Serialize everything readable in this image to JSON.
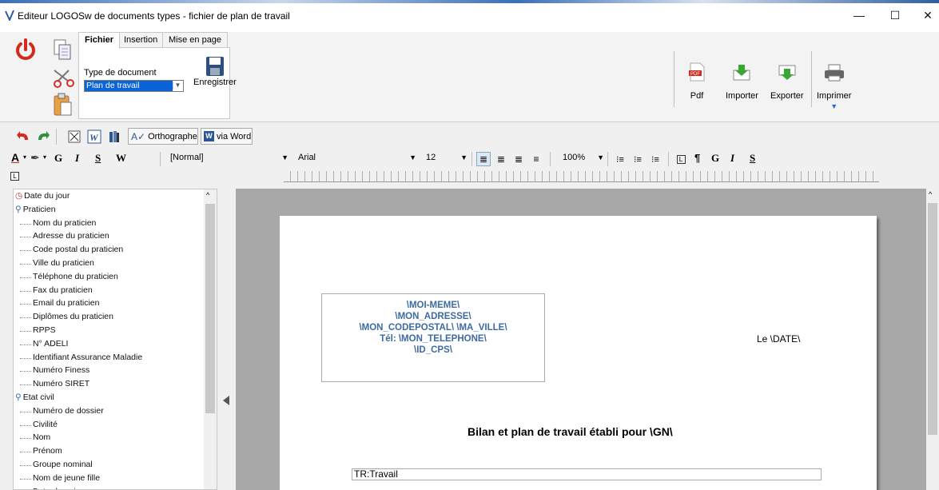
{
  "window": {
    "title": "Editeur LOGOSw de documents types - fichier de plan de travail",
    "minimize": "—",
    "maximize": "☐",
    "close": "✕"
  },
  "ribbon": {
    "tabs": [
      "Fichier",
      "Insertion",
      "Mise en page"
    ],
    "doc_type_label": "Type de document",
    "doc_type_value": "Plan de travail",
    "save_label": "Enregistrer",
    "pdf_label": "Pdf",
    "import_label": "Importer",
    "export_label": "Exporter",
    "print_label": "Imprimer"
  },
  "toolbar1": {
    "spell_label": "Orthographe",
    "via_word_label": "via Word"
  },
  "toolbar2": {
    "bold": "G",
    "italic": "I",
    "underline": "S",
    "word": "W",
    "style_value": "[Normal]",
    "font_value": "Arial",
    "size_value": "12",
    "zoom_value": "100%",
    "bold2": "G",
    "italic2": "I",
    "underline2": "S",
    "pilcrow": "¶"
  },
  "tree": {
    "groups": [
      {
        "label": "Date du jour",
        "icon": "clock-icon",
        "leaves": []
      },
      {
        "label": "Praticien",
        "icon": "person-icon",
        "leaves": [
          "Nom du praticien",
          "Adresse du praticien",
          "Code postal du praticien",
          "Ville du praticien",
          "Téléphone du praticien",
          "Fax du praticien",
          "Email du praticien",
          "Diplômes du praticien",
          "RPPS",
          "N° ADELI",
          "Identifiant Assurance Maladie",
          "Numéro Finess",
          "Numéro SIRET"
        ]
      },
      {
        "label": "Etat civil",
        "icon": "person-icon",
        "leaves": [
          "Numéro de dossier",
          "Civilité",
          "Nom",
          "Prénom",
          "Groupe nominal",
          "Nom de jeune fille",
          "Date de naissance"
        ]
      }
    ]
  },
  "document": {
    "header_lines": [
      "\\MOI-MEME\\",
      "\\MON_ADRESSE\\",
      "\\MON_CODEPOSTAL\\ \\MA_VILLE\\",
      "Tél: \\MON_TELEPHONE\\",
      "\\ID_CPS\\"
    ],
    "date_text": "Le \\DATE\\",
    "title": "Bilan et plan de travail établi pour \\GN\\",
    "field_text": "TR:Travail"
  },
  "colors": {
    "header_text": "#3d6ba3",
    "power": "#d42a1e",
    "accent_green": "#3aa635"
  }
}
